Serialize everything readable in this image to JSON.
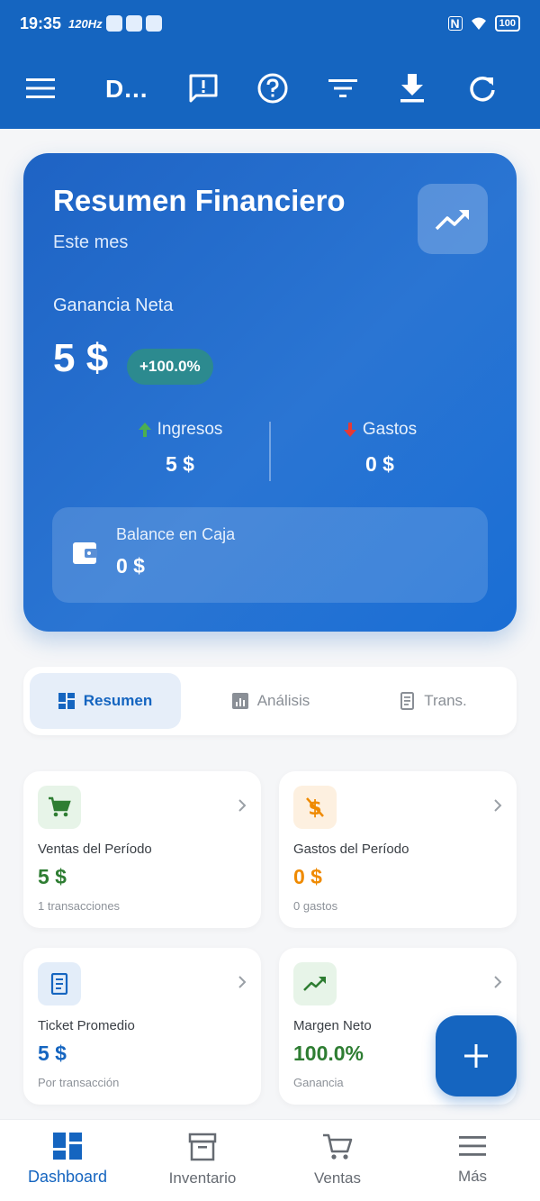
{
  "status_bar": {
    "time": "19:35",
    "refresh_rate": "120Hz",
    "battery": "100"
  },
  "app_bar": {
    "title": "D..."
  },
  "summary_card": {
    "title": "Resumen Financiero",
    "subtitle": "Este mes",
    "net_label": "Ganancia Neta",
    "net_value": "5 $",
    "net_change": "+100.0%",
    "income_label": "Ingresos",
    "income_value": "5 $",
    "expenses_label": "Gastos",
    "expenses_value": "0 $",
    "balance_label": "Balance en Caja",
    "balance_value": "0 $"
  },
  "tabs": [
    {
      "label": "Resumen",
      "active": true
    },
    {
      "label": "Análisis",
      "active": false
    },
    {
      "label": "Trans.",
      "active": false
    }
  ],
  "stats": [
    {
      "label": "Ventas del Período",
      "value": "5 $",
      "note": "1 transacciones",
      "color": "#2e7d32"
    },
    {
      "label": "Gastos del Período",
      "value": "0 $",
      "note": "0 gastos",
      "color": "#ef8a00"
    },
    {
      "label": "Ticket Promedio",
      "value": "5 $",
      "note": "Por transacción",
      "color": "#1565c0"
    },
    {
      "label": "Margen Neto",
      "value": "100.0%",
      "note": "Ganancia",
      "color": "#2e7d32"
    }
  ],
  "bottom_nav": [
    {
      "label": "Dashboard",
      "active": true
    },
    {
      "label": "Inventario",
      "active": false
    },
    {
      "label": "Ventas",
      "active": false
    },
    {
      "label": "Más",
      "active": false
    }
  ],
  "colors": {
    "primary": "#1565c0",
    "income": "#4caf50",
    "expense": "#e53935",
    "badge": "#2c8a8f"
  }
}
